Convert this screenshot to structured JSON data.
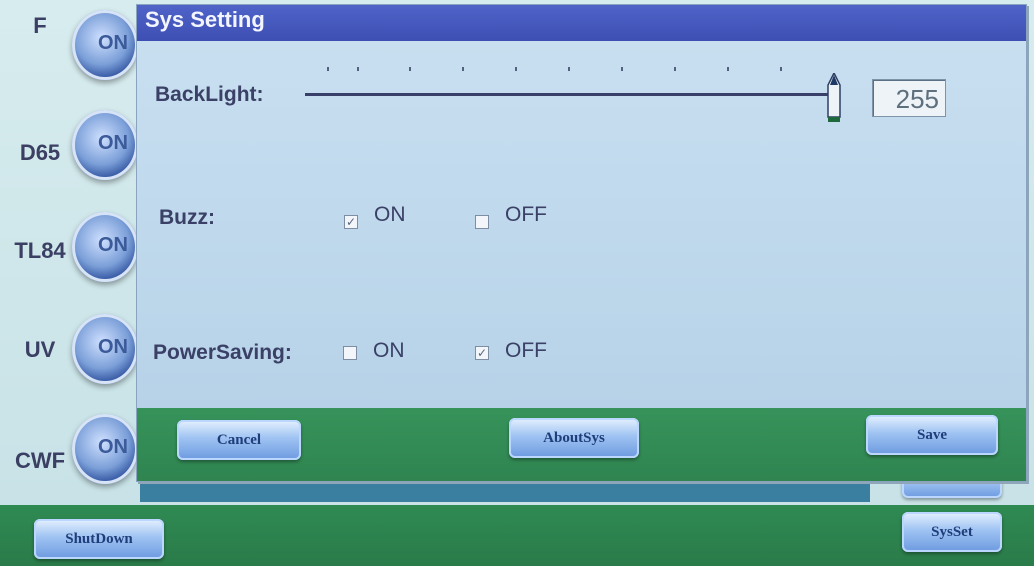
{
  "lamps": [
    {
      "label": "F",
      "button": "ON"
    },
    {
      "label": "D65",
      "button": "ON"
    },
    {
      "label": "TL84",
      "button": "ON"
    },
    {
      "label": "UV",
      "button": "ON"
    },
    {
      "label": "CWF",
      "button": "ON"
    }
  ],
  "bottom_bar": {
    "shutdown_label": "ShutDown",
    "sysset_label": "SysSet"
  },
  "dialog": {
    "title": "Sys Setting",
    "backlight": {
      "label": "BackLight:",
      "value": "255",
      "level_fraction": 1.0
    },
    "buzz": {
      "label": "Buzz:",
      "on_label": "ON",
      "off_label": "OFF",
      "selected": "ON"
    },
    "power_saving": {
      "label": "PowerSaving:",
      "on_label": "ON",
      "off_label": "OFF",
      "selected": "OFF"
    },
    "buttons": {
      "cancel": "Cancel",
      "about": "AboutSys",
      "save": "Save"
    }
  },
  "colors": {
    "title_bar": "#4556bf",
    "footer": "#33905a",
    "dialog_bg": "#c2dbee"
  }
}
